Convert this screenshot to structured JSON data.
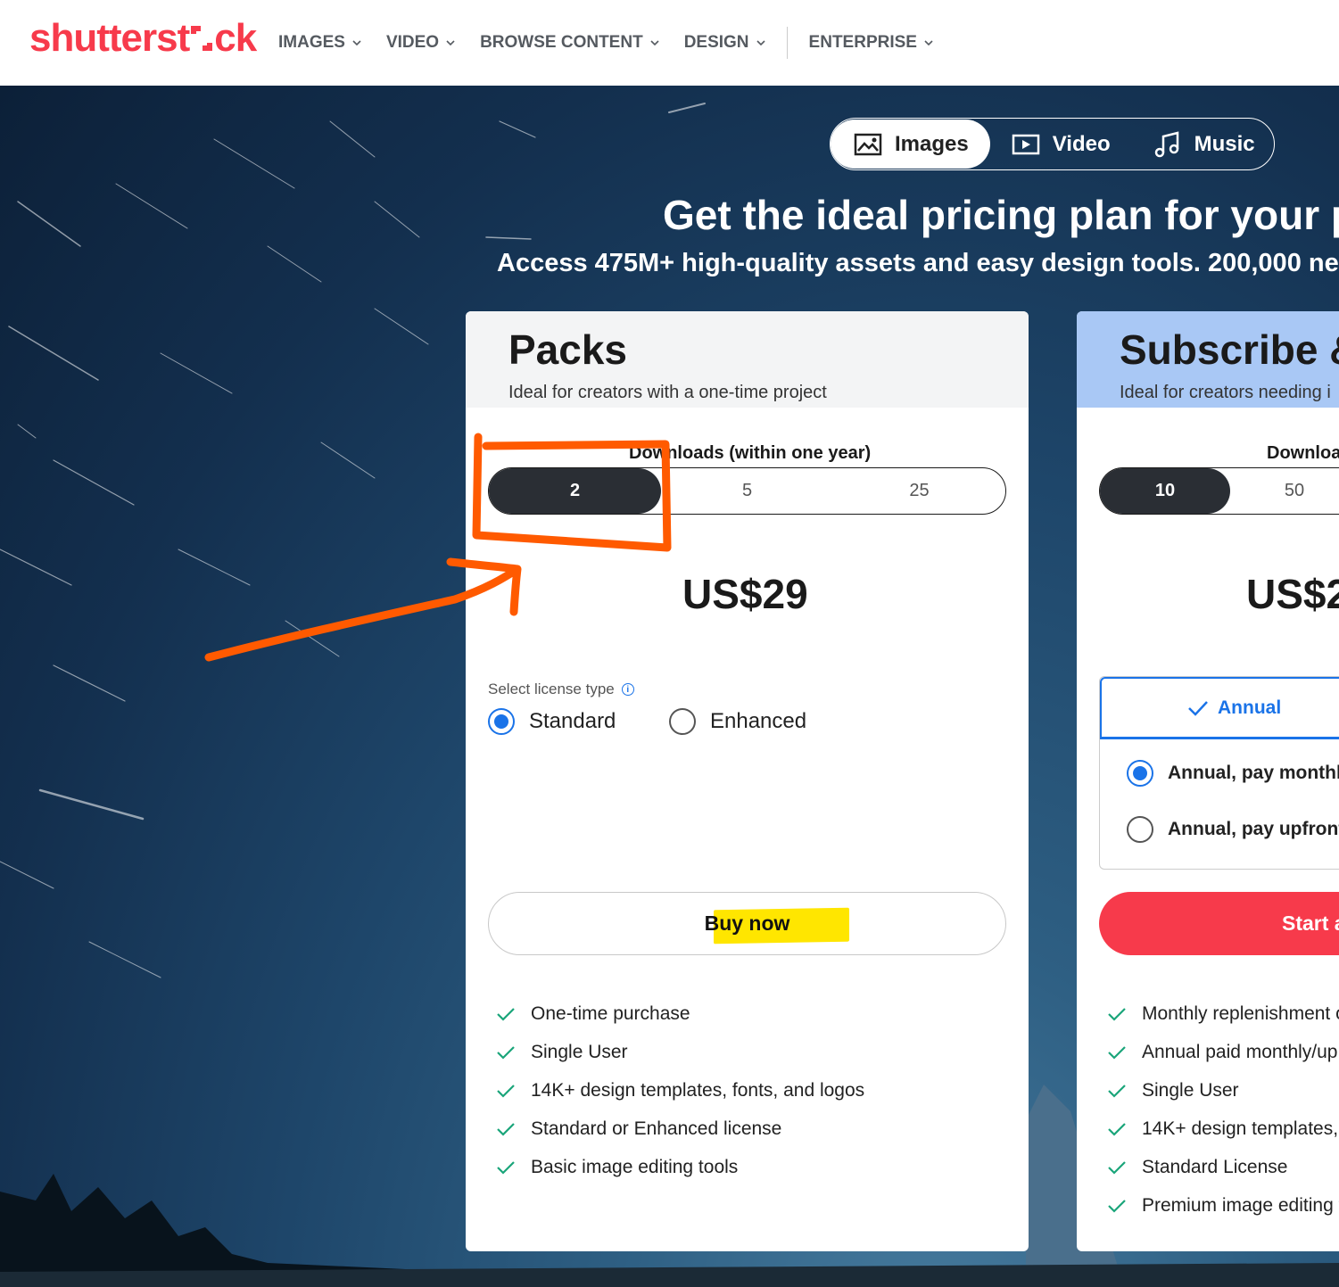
{
  "header": {
    "logo_text": "shutterst",
    "logo_tail": "ck",
    "nav": [
      {
        "label": "IMAGES"
      },
      {
        "label": "VIDEO"
      },
      {
        "label": "BROWSE CONTENT"
      },
      {
        "label": "DESIGN"
      },
      {
        "label": "ENTERPRISE"
      }
    ]
  },
  "media_toggle": {
    "options": [
      {
        "label": "Images",
        "icon": "image-icon",
        "active": true
      },
      {
        "label": "Video",
        "icon": "video-icon",
        "active": false
      },
      {
        "label": "Music",
        "icon": "music-note-icon",
        "active": false
      }
    ]
  },
  "hero": {
    "headline": "Get the ideal pricing plan for your pro",
    "subline": "Access 475M+ high-quality assets and easy design tools. 200,000 ne"
  },
  "packs": {
    "title": "Packs",
    "description": "Ideal for creators with a one-time project",
    "downloads_label": "Downloads (within one year)",
    "download_options": [
      "2",
      "5",
      "25"
    ],
    "selected_downloads": "2",
    "price": "US$29",
    "license_label": "Select license type",
    "licenses": [
      {
        "label": "Standard",
        "selected": true
      },
      {
        "label": "Enhanced",
        "selected": false
      }
    ],
    "buy_label": "Buy now",
    "features": [
      "One-time purchase",
      "Single User",
      "14K+ design templates, fonts, and logos",
      "Standard or Enhanced license",
      "Basic image editing tools"
    ]
  },
  "subscribe": {
    "title": "Subscribe &",
    "description": "Ideal for creators needing i",
    "downloads_label": "Downloa",
    "download_options": [
      "10",
      "50"
    ],
    "selected_downloads": "10",
    "price": "US$2",
    "billing_tab": "Annual",
    "billing_options": [
      {
        "label": "Annual, pay monthly",
        "selected": true
      },
      {
        "label": "Annual, pay upfront",
        "selected": false
      }
    ],
    "start_label": "Start a",
    "features": [
      "Monthly replenishment o",
      "Annual paid monthly/up",
      "Single User",
      "14K+ design templates,",
      "Standard License",
      "Premium image editing t"
    ]
  },
  "colors": {
    "brand": "#f73a4b",
    "accent_blue": "#1a73e8",
    "check_green": "#1aa57a",
    "annotation_orange": "#ff5a00",
    "highlight_yellow": "#ffe600"
  }
}
